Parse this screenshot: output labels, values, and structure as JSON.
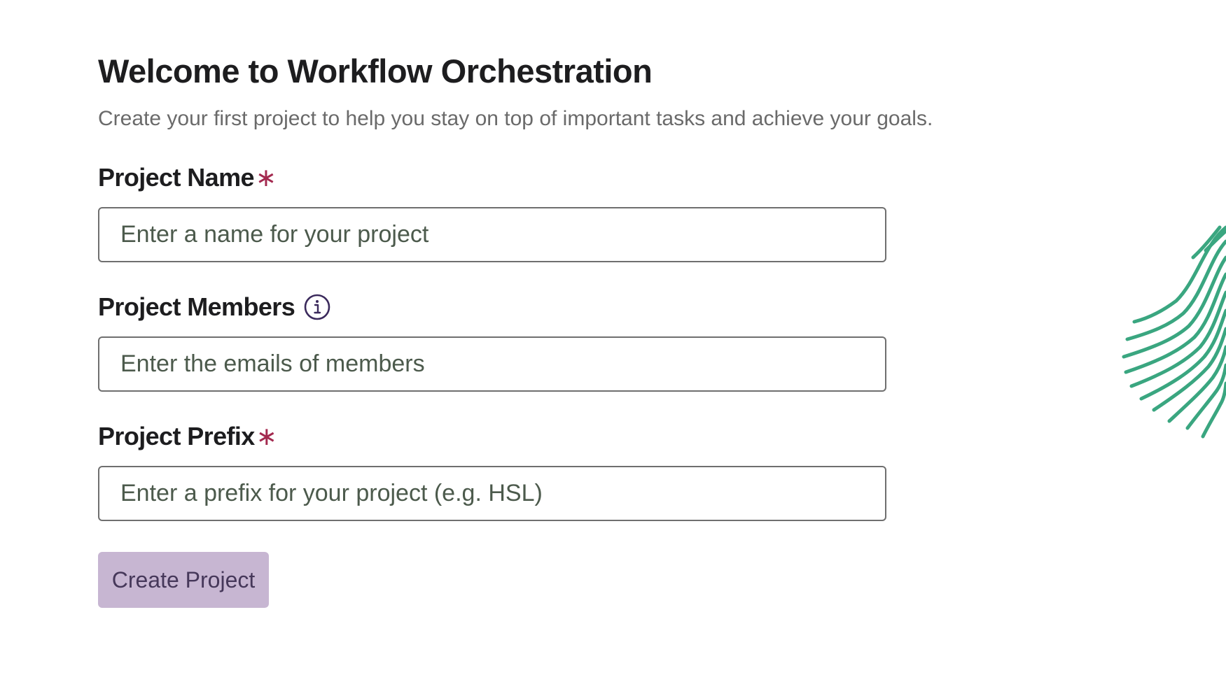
{
  "header": {
    "title": "Welcome to Workflow Orchestration",
    "subtitle": "Create your first project to help you stay on top of important tasks and achieve your goals."
  },
  "fields": {
    "project_name": {
      "label": "Project Name",
      "required_mark": "∗",
      "placeholder": "Enter a name for your project",
      "value": ""
    },
    "project_members": {
      "label": "Project Members",
      "info_icon": "info-icon",
      "placeholder": "Enter the emails of members",
      "value": ""
    },
    "project_prefix": {
      "label": "Project Prefix",
      "required_mark": "∗",
      "placeholder": "Enter a prefix for your project (e.g. HSL)",
      "value": ""
    }
  },
  "actions": {
    "create_label": "Create Project"
  },
  "colors": {
    "required": "#a3294f",
    "button_bg": "#c7b6d2",
    "button_text": "#46385a",
    "decoration": "#3aa680",
    "info_icon": "#3b2a5c"
  },
  "decoration": {
    "icon": "curved-stripes-graphic"
  }
}
